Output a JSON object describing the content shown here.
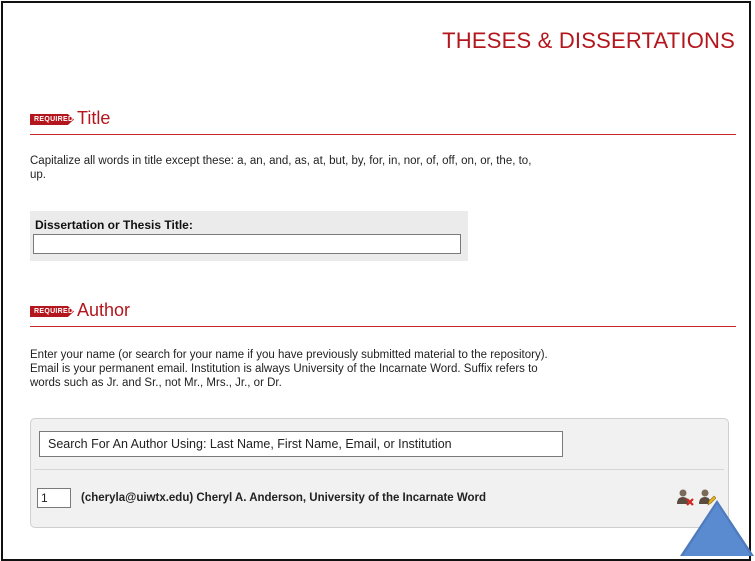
{
  "page": {
    "title": "THESES & DISSERTATIONS"
  },
  "title_section": {
    "badge": "REQUIRED",
    "heading": "Title",
    "help": "Capitalize all words in title except these: a, an, and, as, at, but, by, for, in, nor, of, off, on, or, the, to, up.",
    "field_label": "Dissertation or Thesis Title:",
    "field_value": ""
  },
  "author_section": {
    "badge": "REQUIRED",
    "heading": "Author",
    "help": "Enter your name (or search for your name if you have previously submitted material to the repository). Email is your permanent email. Institution is always University of the Incarnate Word. Suffix refers to words such as Jr. and Sr., not Mr., Mrs., Jr., or Dr.",
    "search_placeholder": "Search For An Author Using: Last Name, First Name, Email, or Institution",
    "authors": [
      {
        "order": "1",
        "text": "(cheryla@uiwtx.edu) Cheryl A. Anderson, University of the Incarnate Word"
      }
    ]
  },
  "icons": {
    "remove": "remove-author-icon",
    "edit": "edit-author-icon"
  },
  "colors": {
    "accent": "#b3161c",
    "arrow": "#4f7bbd"
  }
}
